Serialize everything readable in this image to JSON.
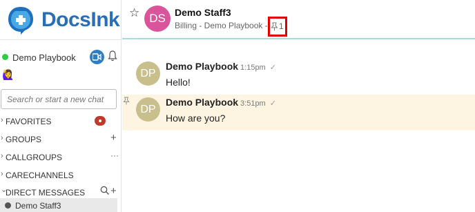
{
  "app": {
    "brand": "DocsInk"
  },
  "user": {
    "name": "Demo Playbook",
    "emoji": "🙋‍♀️"
  },
  "search": {
    "placeholder": "Search or start a new chat"
  },
  "sections": {
    "favorites": "FAVORITES",
    "groups": "GROUPS",
    "callgroups": "CALLGROUPS",
    "carechannels": "CARECHANNELS",
    "direct_messages": "DIRECT MESSAGES",
    "plus": "+",
    "more": "···",
    "chevron": "›",
    "chevron_open": "⌄"
  },
  "dm_items": [
    {
      "name": "Demo Staff3"
    }
  ],
  "chat": {
    "initials": "DS",
    "name": "Demo Staff3",
    "subtitle": "Billing - Demo Playbook  -",
    "pin_count": "1",
    "star": "☆"
  },
  "messages": [
    {
      "initials": "DP",
      "author": "Demo Playbook",
      "time": "1:15pm",
      "check": "✓",
      "text": "Hello!"
    },
    {
      "initials": "DP",
      "author": "Demo Playbook",
      "time": "3:51pm",
      "check": "✓",
      "text": "How are you?"
    }
  ],
  "colors": {
    "brand": "#2a6fb5",
    "online": "#2ecc40",
    "avatar_chat": "#d9549a",
    "avatar_msg": "#c9bf8c",
    "highlight": "#fdf5e2",
    "pin_box": "#e00000"
  }
}
